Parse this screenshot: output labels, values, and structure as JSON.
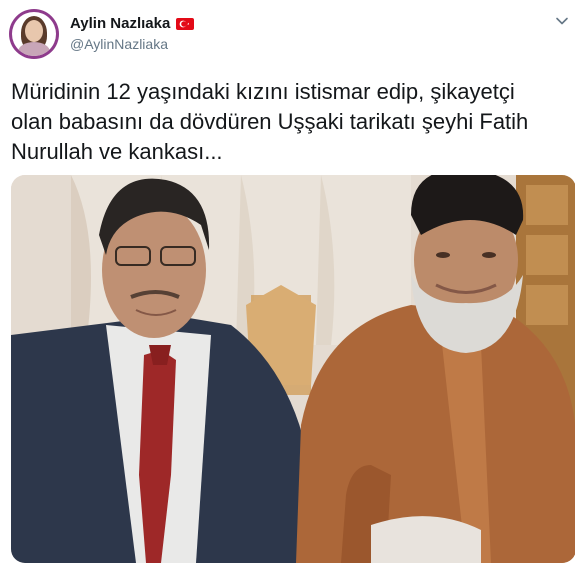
{
  "author": {
    "display_name": "Aylin Nazlıaka",
    "handle": "@AylinNazliaka",
    "flag_icon": "turkey-flag-icon",
    "avatar_icon": "profile-avatar"
  },
  "tweet": {
    "text": "Müridinin 12 yaşındaki kızını istismar edip, şikayetçi\nolan babasını da dövdüren Uşşaki tarikatı şeyhi Fatih\nNurullah ve kankası..."
  },
  "menu": {
    "icon": "chevron-down-icon"
  },
  "colors": {
    "name_text": "#14171a",
    "handle_text": "#657786",
    "avatar_ring": "#8e3b8c",
    "flag_red": "#e30a17"
  }
}
